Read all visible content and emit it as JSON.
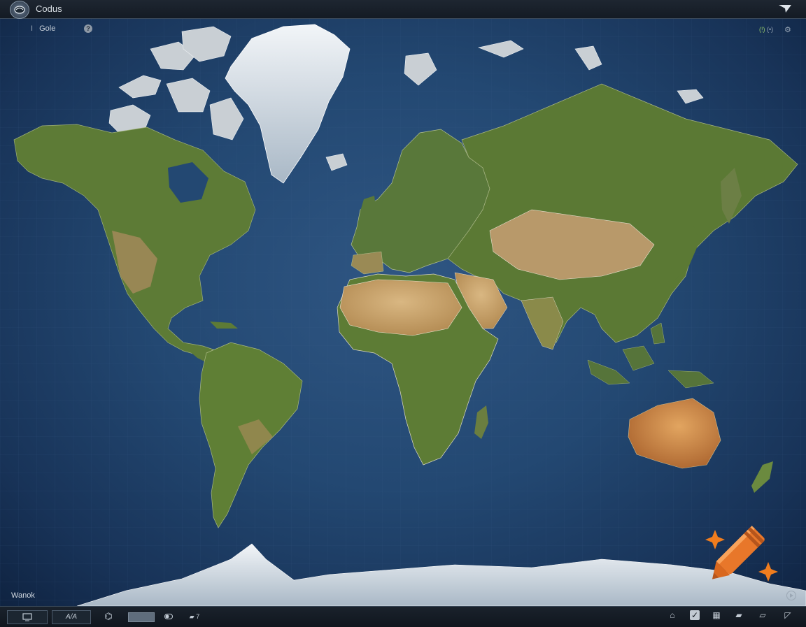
{
  "app": {
    "title": "Codus"
  },
  "toolbar": {
    "search_value": "Gole",
    "separator": "I",
    "help_label": "?"
  },
  "indicators": {
    "green_label": "(!)",
    "secondary_label": "(•)"
  },
  "status": {
    "label": "Wanok"
  },
  "bottombar": {
    "text_label": "A/A",
    "layers_label": "▰ 7"
  },
  "icons": {
    "logo": "globe-logo-icon",
    "corner": "arrow-corner-icon",
    "help": "help-icon",
    "settings": "gear-icon",
    "play": "play-icon",
    "crayon": "crayon-icon"
  },
  "colors": {
    "ocean": "#234872",
    "land": "#5c7a34",
    "desert": "#c9a66b",
    "ice": "#e8edf2",
    "accent": "#f07d1e"
  }
}
